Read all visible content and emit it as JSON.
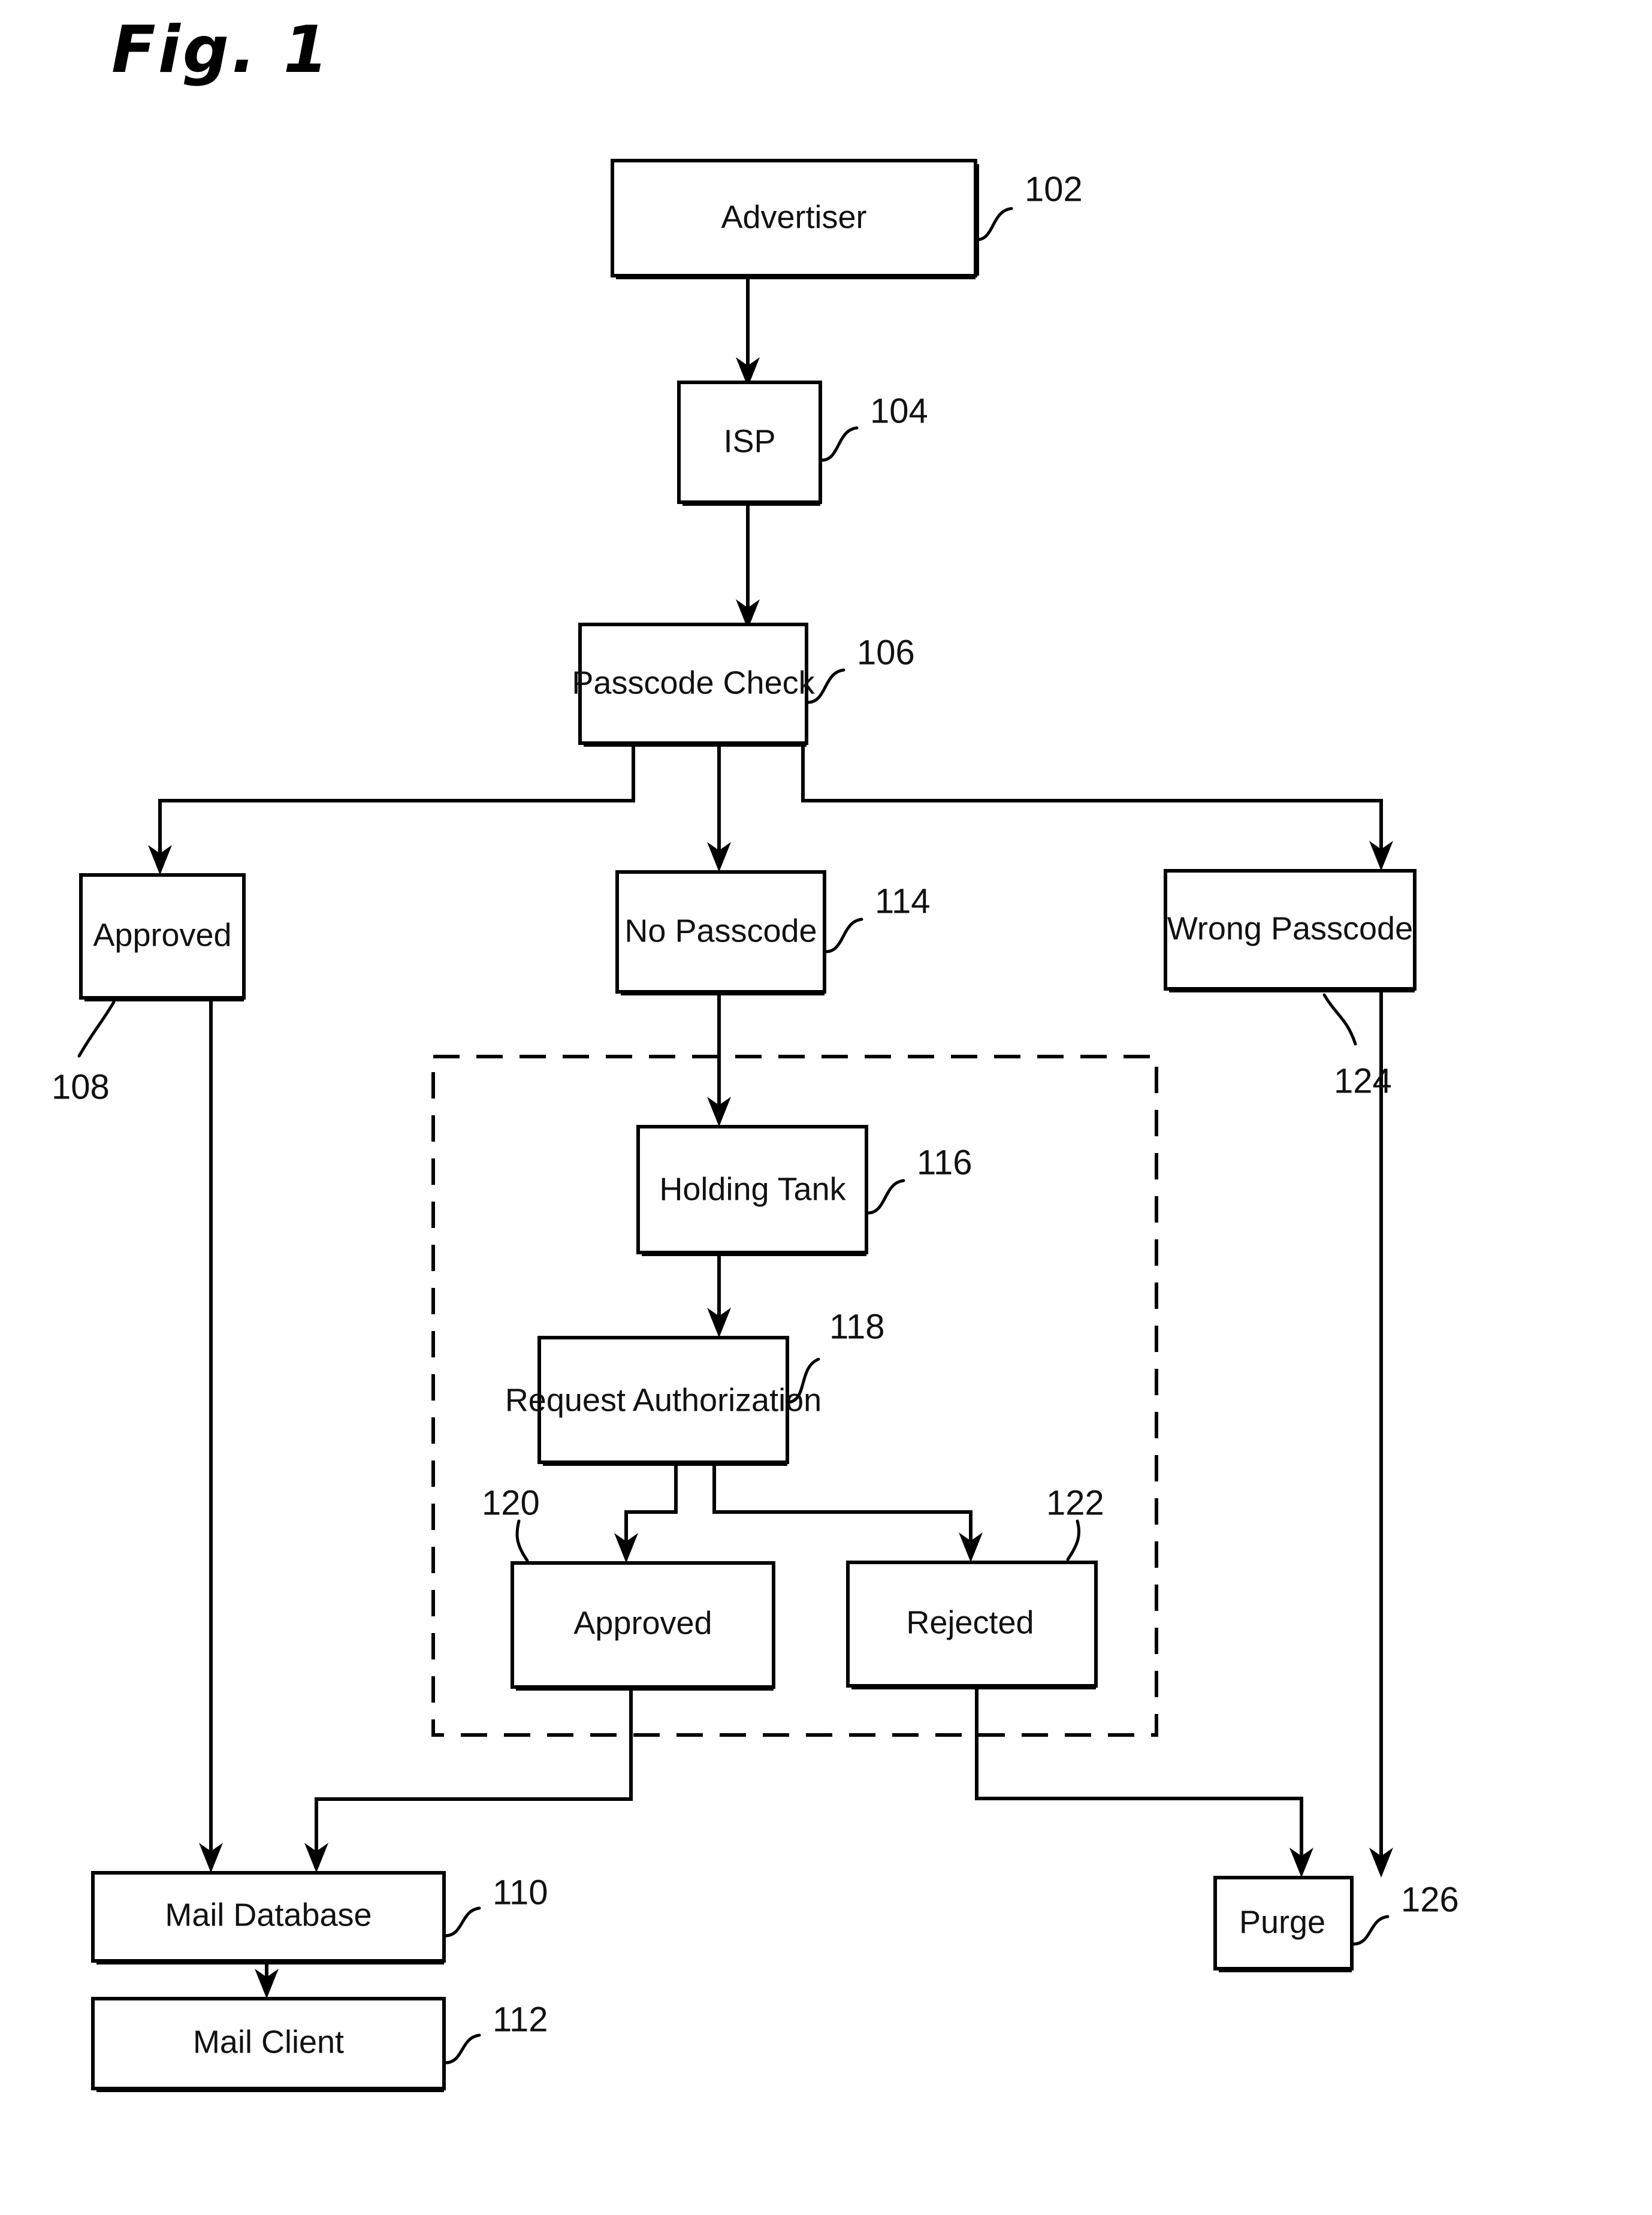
{
  "figure": {
    "title": "Fig. 1",
    "type": "patent-flow-diagram"
  },
  "nodes": {
    "advertiser": {
      "label": "Advertiser",
      "ref": "102"
    },
    "isp": {
      "label": "ISP",
      "ref": "104"
    },
    "passcode_check": {
      "label": "Passcode Check",
      "ref": "106"
    },
    "approved_top": {
      "label": "Approved",
      "ref": "108"
    },
    "no_passcode": {
      "label": "No Passcode",
      "ref": "114"
    },
    "wrong_passcode": {
      "label": "Wrong Passcode",
      "ref": "124"
    },
    "holding_tank": {
      "label": "Holding Tank",
      "ref": "116"
    },
    "request_authorization": {
      "label": "Request Authorization",
      "ref": "118"
    },
    "approved_inner": {
      "label": "Approved",
      "ref": "120"
    },
    "rejected": {
      "label": "Rejected",
      "ref": "122"
    },
    "mail_database": {
      "label": "Mail Database",
      "ref": "110"
    },
    "mail_client": {
      "label": "Mail Client",
      "ref": "112"
    },
    "purge": {
      "label": "Purge",
      "ref": "126"
    }
  },
  "colors": {
    "ink": "#000000",
    "paper": "#ffffff"
  }
}
